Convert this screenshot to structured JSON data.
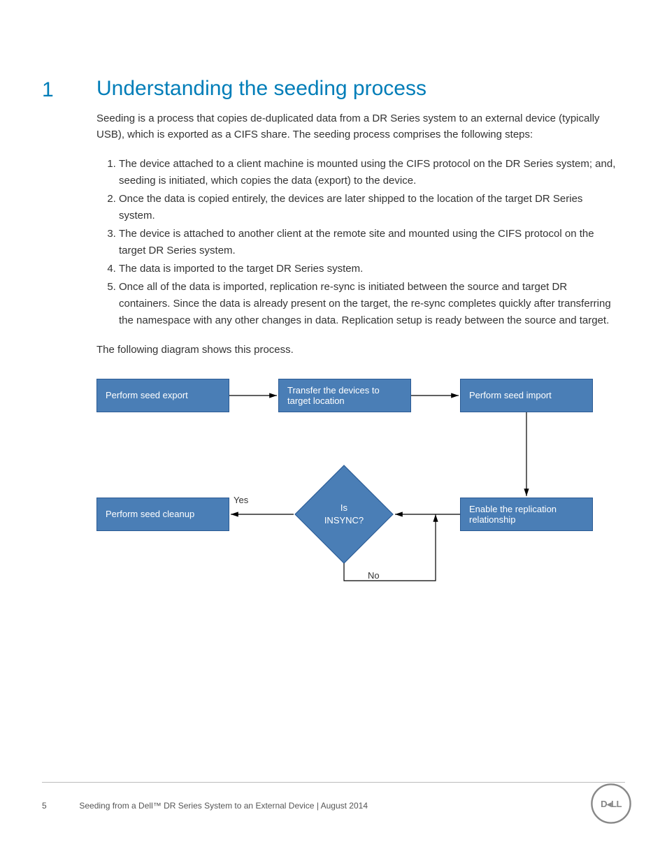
{
  "section_number": "1",
  "title": "Understanding the seeding process",
  "intro": "Seeding is a process that copies de-duplicated data from a DR Series system to an external device (typically USB), which is exported as a CIFS share. The seeding process comprises the following steps:",
  "steps": [
    "The device attached to a client machine is mounted using the CIFS protocol on the DR Series system; and, seeding is initiated, which copies the data (export) to the device.",
    "Once the data is copied entirely, the devices are later shipped to the location of the target DR Series system.",
    "The device is attached to another client at the remote site and mounted using the CIFS protocol on the target DR Series system.",
    "The data is imported to the target DR Series system.",
    "Once all of the data is imported, replication re-sync is initiated between the source and target DR containers. Since the data is already present on the target, the re-sync completes quickly after transferring the namespace with any other changes in data. Replication setup is ready between the source and target."
  ],
  "diagram_lead": "The following diagram shows this process.",
  "diagram": {
    "box_export": "Perform seed export",
    "box_transfer": "Transfer the devices to target location",
    "box_import": "Perform seed import",
    "box_enable": "Enable the replication relationship",
    "box_cleanup": "Perform seed cleanup",
    "diamond_line1": "Is",
    "diamond_line2": "INSYNC?",
    "label_yes": "Yes",
    "label_no": "No"
  },
  "footer": {
    "page_number": "5",
    "text": "Seeding from a Dell™ DR Series System to an External Device | August 2014"
  }
}
